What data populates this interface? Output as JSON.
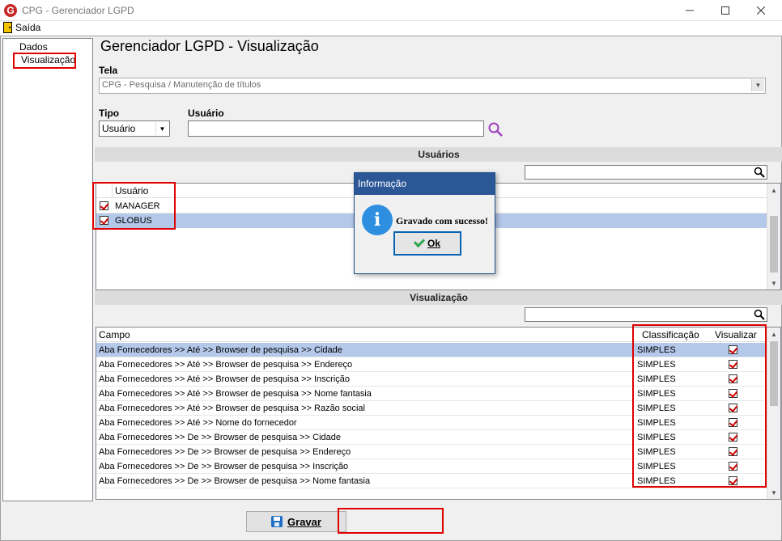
{
  "window": {
    "title": "CPG - Gerenciador LGPD",
    "app_icon_letter": "G"
  },
  "menu": {
    "items": [
      {
        "label": "Saída",
        "icon": "door-icon"
      }
    ]
  },
  "tree": {
    "items": [
      {
        "label": "Dados"
      },
      {
        "label": "Visualização"
      }
    ]
  },
  "page": {
    "title": "Gerenciador LGPD - Visualização",
    "tela_label": "Tela",
    "tela_value": "CPG - Pesquisa / Manutenção de títulos",
    "tipo_label": "Tipo",
    "tipo_value": "Usuário",
    "usuario_label": "Usuário",
    "usuario_value": ""
  },
  "usuarios_section": {
    "title": "Usuários",
    "search_value": "",
    "column_header": "Usuário",
    "rows": [
      {
        "name": "MANAGER",
        "checked": true,
        "selected": false
      },
      {
        "name": "GLOBUS",
        "checked": true,
        "selected": true
      }
    ]
  },
  "visualizacao_section": {
    "title": "Visualização",
    "search_value": "",
    "columns": [
      "Campo",
      "Classificação",
      "Visualizar"
    ],
    "rows": [
      {
        "campo": "Aba Fornecedores >> Até >> Browser de pesquisa >> Cidade",
        "classificacao": "SIMPLES",
        "visualizar": true,
        "selected": true
      },
      {
        "campo": "Aba Fornecedores >> Até >> Browser de pesquisa >> Endereço",
        "classificacao": "SIMPLES",
        "visualizar": true
      },
      {
        "campo": "Aba Fornecedores >> Até >> Browser de pesquisa >> Inscrição",
        "classificacao": "SIMPLES",
        "visualizar": true
      },
      {
        "campo": "Aba Fornecedores >> Até >> Browser de pesquisa >> Nome fantasia",
        "classificacao": "SIMPLES",
        "visualizar": true
      },
      {
        "campo": "Aba Fornecedores >> Até >> Browser de pesquisa >> Razão social",
        "classificacao": "SIMPLES",
        "visualizar": true
      },
      {
        "campo": "Aba Fornecedores >> Até >> Nome do fornecedor",
        "classificacao": "SIMPLES",
        "visualizar": true
      },
      {
        "campo": "Aba Fornecedores >> De >> Browser de pesquisa >> Cidade",
        "classificacao": "SIMPLES",
        "visualizar": true
      },
      {
        "campo": "Aba Fornecedores >> De >> Browser de pesquisa >> Endereço",
        "classificacao": "SIMPLES",
        "visualizar": true
      },
      {
        "campo": "Aba Fornecedores >> De >> Browser de pesquisa >> Inscrição",
        "classificacao": "SIMPLES",
        "visualizar": true
      },
      {
        "campo": "Aba Fornecedores >> De >> Browser de pesquisa >> Nome fantasia",
        "classificacao": "SIMPLES",
        "visualizar": true
      }
    ]
  },
  "footer": {
    "gravar_label": "Gravar"
  },
  "dialog": {
    "title": "Informação",
    "message": "Gravado com sucesso!",
    "ok_label": "Ok",
    "icon": "info-icon"
  },
  "colors": {
    "highlight_box": "#e00000",
    "selection": "#b4c8ea",
    "dialog_titlebar": "#2b5797",
    "section_bar": "#dcdcdc"
  }
}
